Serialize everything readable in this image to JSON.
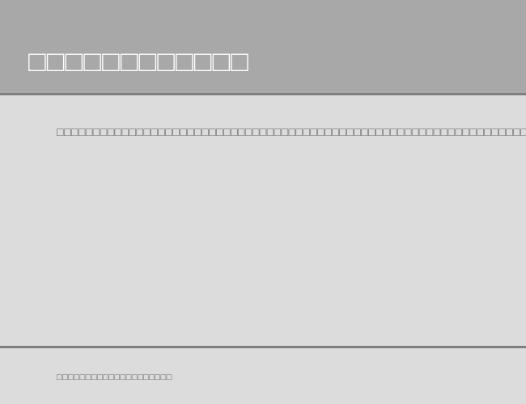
{
  "header": {
    "title": "□□□□□□□□□□□□"
  },
  "content": {
    "text": "□□□□□□□□□□□□□□□□□□□□□□□□□□□□□□□□□□□□□□□□□□□□□□□□□□□□□□□□□□□□□□□□□□□□□□□□□□□□□□□□□□□□□□□□□□□□□□□□□□□□□□□□□□□□□□□□□□□□□□□□□□□□□□□□□□□□□□□□"
  },
  "footer": {
    "text": "□□□□□□□□□□□□□□□□□□□□"
  }
}
